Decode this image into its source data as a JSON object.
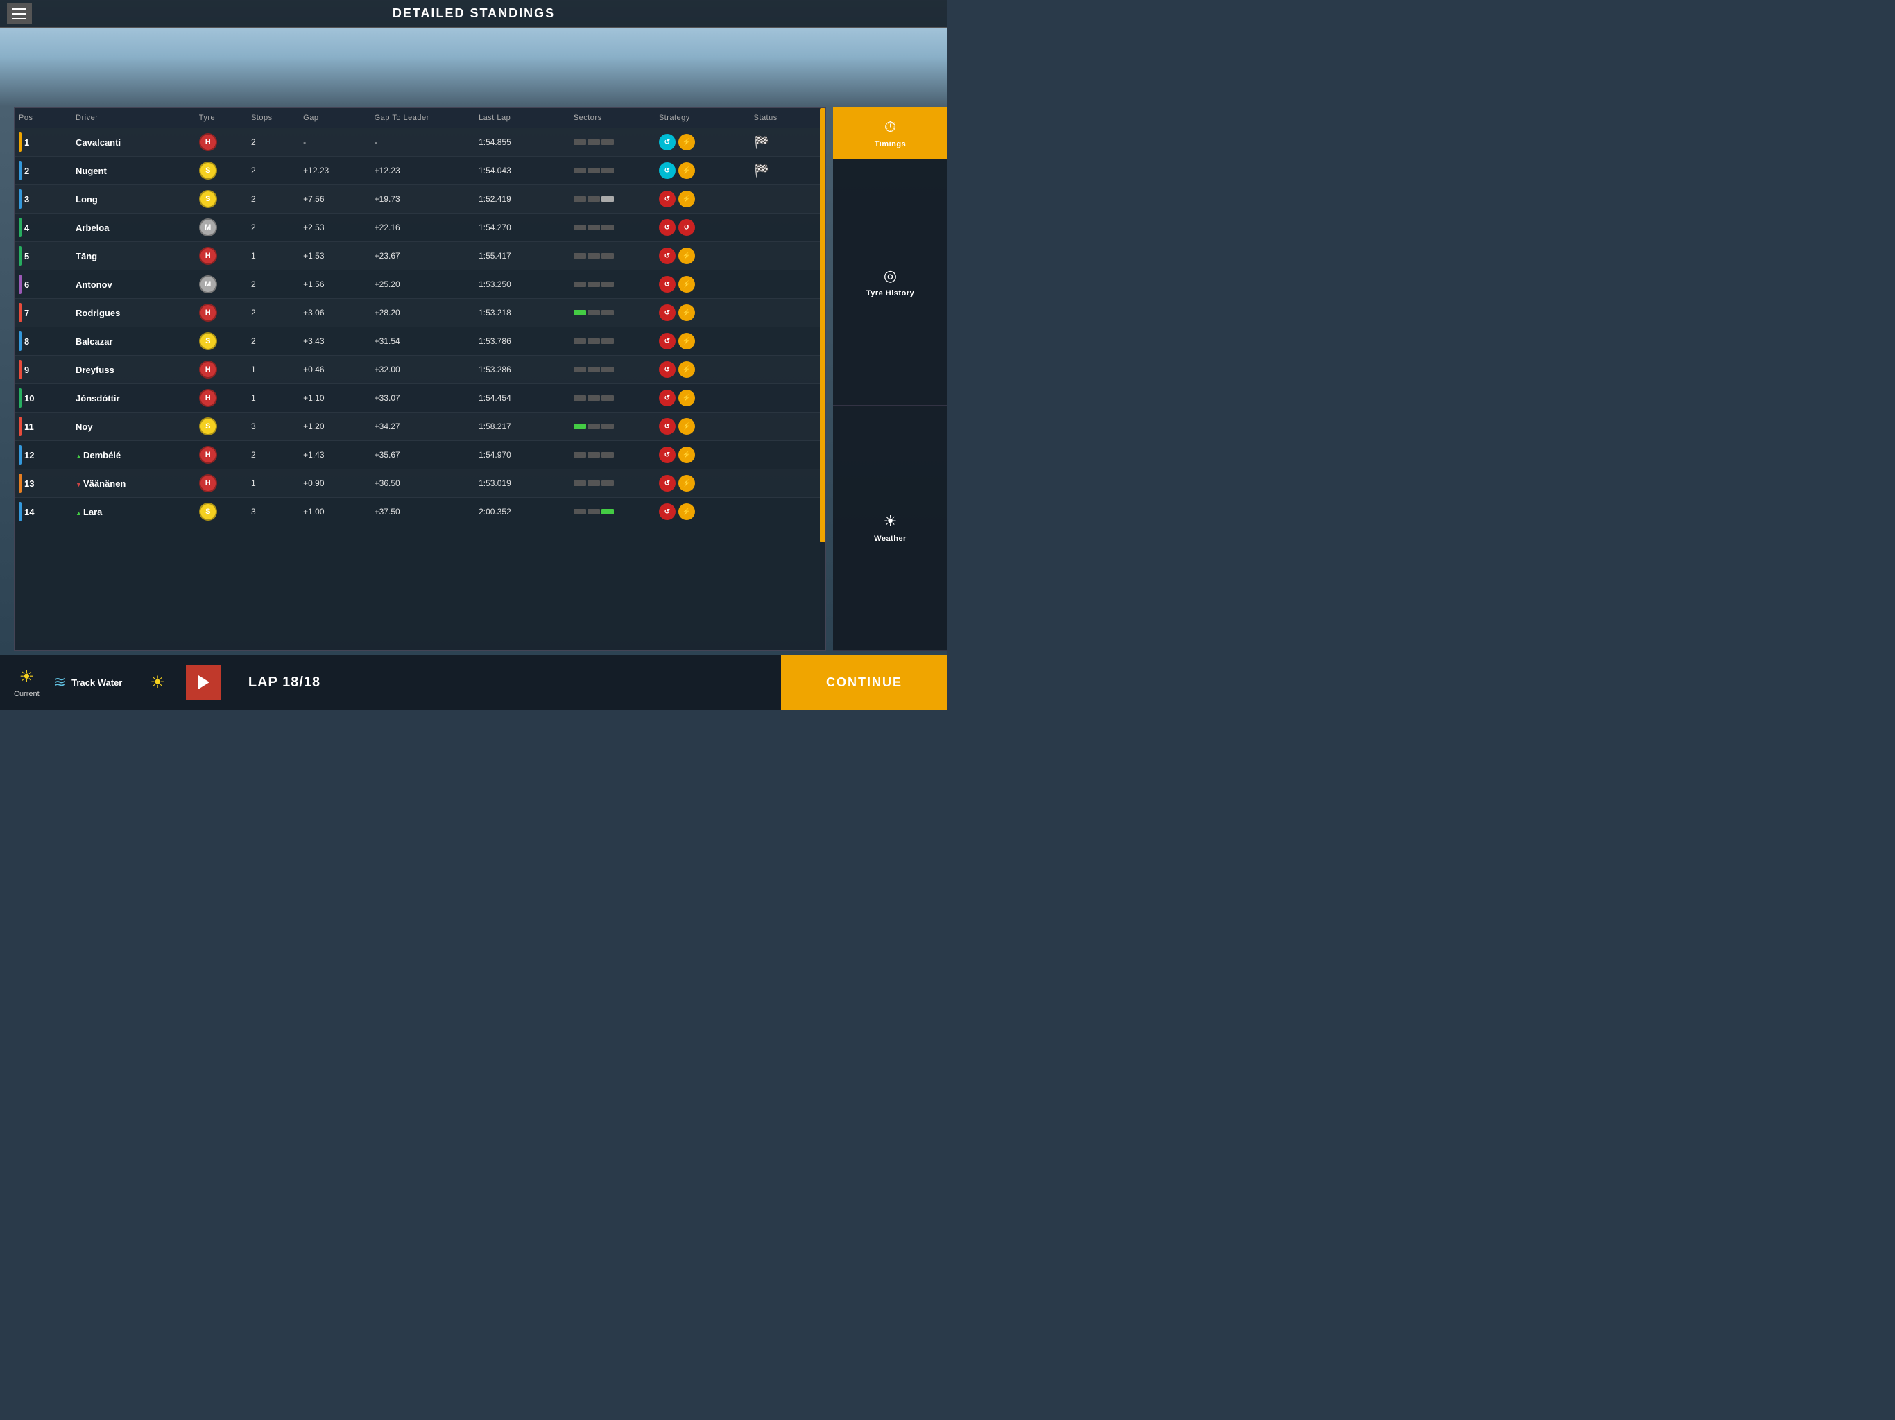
{
  "header": {
    "title": "DETAILED STANDINGS",
    "menu_label": "Menu"
  },
  "table": {
    "columns": [
      "Pos",
      "Driver",
      "Tyre",
      "Stops",
      "Gap",
      "Gap To Leader",
      "Last Lap",
      "Sectors",
      "Strategy",
      "Status"
    ],
    "rows": [
      {
        "pos": 1,
        "driver": "Cavalcanti",
        "tyre": "H",
        "tyre_color": "#cc3333",
        "team_color": "#f0a500",
        "stops": 2,
        "gap": "-",
        "gap_leader": "-",
        "last_lap": "1:54.855",
        "sectors": [
          "#555",
          "#555",
          "#555"
        ],
        "strategy": [
          {
            "color": "#00bcd4",
            "icon": "↺"
          },
          {
            "color": "#f0a500",
            "icon": "⚡"
          }
        ],
        "status": "flag",
        "arrow": ""
      },
      {
        "pos": 2,
        "driver": "Nugent",
        "tyre": "S",
        "tyre_color": "#f5d020",
        "team_color": "#3498db",
        "stops": 2,
        "gap": "+12.23",
        "gap_leader": "+12.23",
        "last_lap": "1:54.043",
        "sectors": [
          "#555",
          "#555",
          "#555"
        ],
        "strategy": [
          {
            "color": "#00bcd4",
            "icon": "↺"
          },
          {
            "color": "#f0a500",
            "icon": "⚡"
          }
        ],
        "status": "flag",
        "arrow": ""
      },
      {
        "pos": 3,
        "driver": "Long",
        "tyre": "S",
        "tyre_color": "#f5d020",
        "team_color": "#3498db",
        "stops": 2,
        "gap": "+7.56",
        "gap_leader": "+19.73",
        "last_lap": "1:52.419",
        "sectors": [
          "#555",
          "#555",
          "#aaa"
        ],
        "strategy": [
          {
            "color": "#cc2222",
            "icon": "↺"
          },
          {
            "color": "#f0a500",
            "icon": "⚡"
          }
        ],
        "status": "",
        "arrow": ""
      },
      {
        "pos": 4,
        "driver": "Arbeloa",
        "tyre": "M",
        "tyre_color": "#aaaaaa",
        "team_color": "#27ae60",
        "stops": 2,
        "gap": "+2.53",
        "gap_leader": "+22.16",
        "last_lap": "1:54.270",
        "sectors": [
          "#555",
          "#555",
          "#555"
        ],
        "strategy": [
          {
            "color": "#cc2222",
            "icon": "↺"
          },
          {
            "color": "#cc2222",
            "icon": "↺"
          }
        ],
        "status": "",
        "arrow": ""
      },
      {
        "pos": 5,
        "driver": "Tāng",
        "tyre": "H",
        "tyre_color": "#cc3333",
        "team_color": "#27ae60",
        "stops": 1,
        "gap": "+1.53",
        "gap_leader": "+23.67",
        "last_lap": "1:55.417",
        "sectors": [
          "#555",
          "#555",
          "#555"
        ],
        "strategy": [
          {
            "color": "#cc2222",
            "icon": "↺"
          },
          {
            "color": "#f0a500",
            "icon": "⚡"
          }
        ],
        "status": "",
        "arrow": ""
      },
      {
        "pos": 6,
        "driver": "Antonov",
        "tyre": "M",
        "tyre_color": "#aaaaaa",
        "team_color": "#9b59b6",
        "stops": 2,
        "gap": "+1.56",
        "gap_leader": "+25.20",
        "last_lap": "1:53.250",
        "sectors": [
          "#555",
          "#555",
          "#555"
        ],
        "strategy": [
          {
            "color": "#cc2222",
            "icon": "↺"
          },
          {
            "color": "#f0a500",
            "icon": "⚡"
          }
        ],
        "status": "",
        "arrow": ""
      },
      {
        "pos": 7,
        "driver": "Rodrigues",
        "tyre": "H",
        "tyre_color": "#cc3333",
        "team_color": "#e74c3c",
        "stops": 2,
        "gap": "+3.06",
        "gap_leader": "+28.20",
        "last_lap": "1:53.218",
        "sectors": [
          "#44cc44",
          "#555",
          "#555"
        ],
        "strategy": [
          {
            "color": "#cc2222",
            "icon": "↺"
          },
          {
            "color": "#f0a500",
            "icon": "⚡"
          }
        ],
        "status": "",
        "arrow": ""
      },
      {
        "pos": 8,
        "driver": "Balcazar",
        "tyre": "S",
        "tyre_color": "#f5d020",
        "team_color": "#3498db",
        "stops": 2,
        "gap": "+3.43",
        "gap_leader": "+31.54",
        "last_lap": "1:53.786",
        "sectors": [
          "#555",
          "#555",
          "#555"
        ],
        "strategy": [
          {
            "color": "#cc2222",
            "icon": "↺"
          },
          {
            "color": "#f0a500",
            "icon": "⚡"
          }
        ],
        "status": "",
        "arrow": ""
      },
      {
        "pos": 9,
        "driver": "Dreyfuss",
        "tyre": "H",
        "tyre_color": "#cc3333",
        "team_color": "#e74c3c",
        "stops": 1,
        "gap": "+0.46",
        "gap_leader": "+32.00",
        "last_lap": "1:53.286",
        "sectors": [
          "#555",
          "#555",
          "#555"
        ],
        "strategy": [
          {
            "color": "#cc2222",
            "icon": "↺"
          },
          {
            "color": "#f0a500",
            "icon": "⚡"
          }
        ],
        "status": "",
        "arrow": ""
      },
      {
        "pos": 10,
        "driver": "Jónsdóttir",
        "tyre": "H",
        "tyre_color": "#cc3333",
        "team_color": "#27ae60",
        "stops": 1,
        "gap": "+1.10",
        "gap_leader": "+33.07",
        "last_lap": "1:54.454",
        "sectors": [
          "#555",
          "#555",
          "#555"
        ],
        "strategy": [
          {
            "color": "#cc2222",
            "icon": "↺"
          },
          {
            "color": "#f0a500",
            "icon": "⚡"
          }
        ],
        "status": "",
        "arrow": ""
      },
      {
        "pos": 11,
        "driver": "Noy",
        "tyre": "S",
        "tyre_color": "#f5d020",
        "team_color": "#e74c3c",
        "stops": 3,
        "gap": "+1.20",
        "gap_leader": "+34.27",
        "last_lap": "1:58.217",
        "sectors": [
          "#44cc44",
          "#555",
          "#555"
        ],
        "strategy": [
          {
            "color": "#cc2222",
            "icon": "↺"
          },
          {
            "color": "#f0a500",
            "icon": "⚡"
          }
        ],
        "status": "",
        "arrow": ""
      },
      {
        "pos": 12,
        "driver": "Dembélé",
        "tyre": "H",
        "tyre_color": "#cc3333",
        "team_color": "#3498db",
        "stops": 2,
        "gap": "+1.43",
        "gap_leader": "+35.67",
        "last_lap": "1:54.970",
        "sectors": [
          "#555",
          "#555",
          "#555"
        ],
        "strategy": [
          {
            "color": "#cc2222",
            "icon": "↺"
          },
          {
            "color": "#f0a500",
            "icon": "⚡"
          }
        ],
        "status": "",
        "arrow": "up"
      },
      {
        "pos": 13,
        "driver": "Väänänen",
        "tyre": "H",
        "tyre_color": "#cc3333",
        "team_color": "#e67e22",
        "stops": 1,
        "gap": "+0.90",
        "gap_leader": "+36.50",
        "last_lap": "1:53.019",
        "sectors": [
          "#555",
          "#555",
          "#555"
        ],
        "strategy": [
          {
            "color": "#cc2222",
            "icon": "↺"
          },
          {
            "color": "#f0a500",
            "icon": "⚡"
          }
        ],
        "status": "",
        "arrow": "down"
      },
      {
        "pos": 14,
        "driver": "Lara",
        "tyre": "S",
        "tyre_color": "#f5d020",
        "team_color": "#3498db",
        "stops": 3,
        "gap": "+1.00",
        "gap_leader": "+37.50",
        "last_lap": "2:00.352",
        "sectors": [
          "#555",
          "#555",
          "#44cc44"
        ],
        "strategy": [
          {
            "color": "#cc2222",
            "icon": "↺"
          },
          {
            "color": "#f0a500",
            "icon": "⚡"
          }
        ],
        "status": "",
        "arrow": "up"
      }
    ]
  },
  "sidebar": {
    "items": [
      {
        "id": "timings",
        "label": "Timings",
        "icon": "⏱",
        "active": true
      },
      {
        "id": "tyre-history",
        "label": "Tyre History",
        "icon": "◎",
        "active": false
      },
      {
        "id": "weather",
        "label": "Weather",
        "icon": "☀",
        "active": false
      }
    ]
  },
  "bottom_bar": {
    "weather_label": "Current",
    "track_water_label": "Track Water",
    "lap_info": "LAP 18/18",
    "continue_label": "CONTINUE"
  }
}
